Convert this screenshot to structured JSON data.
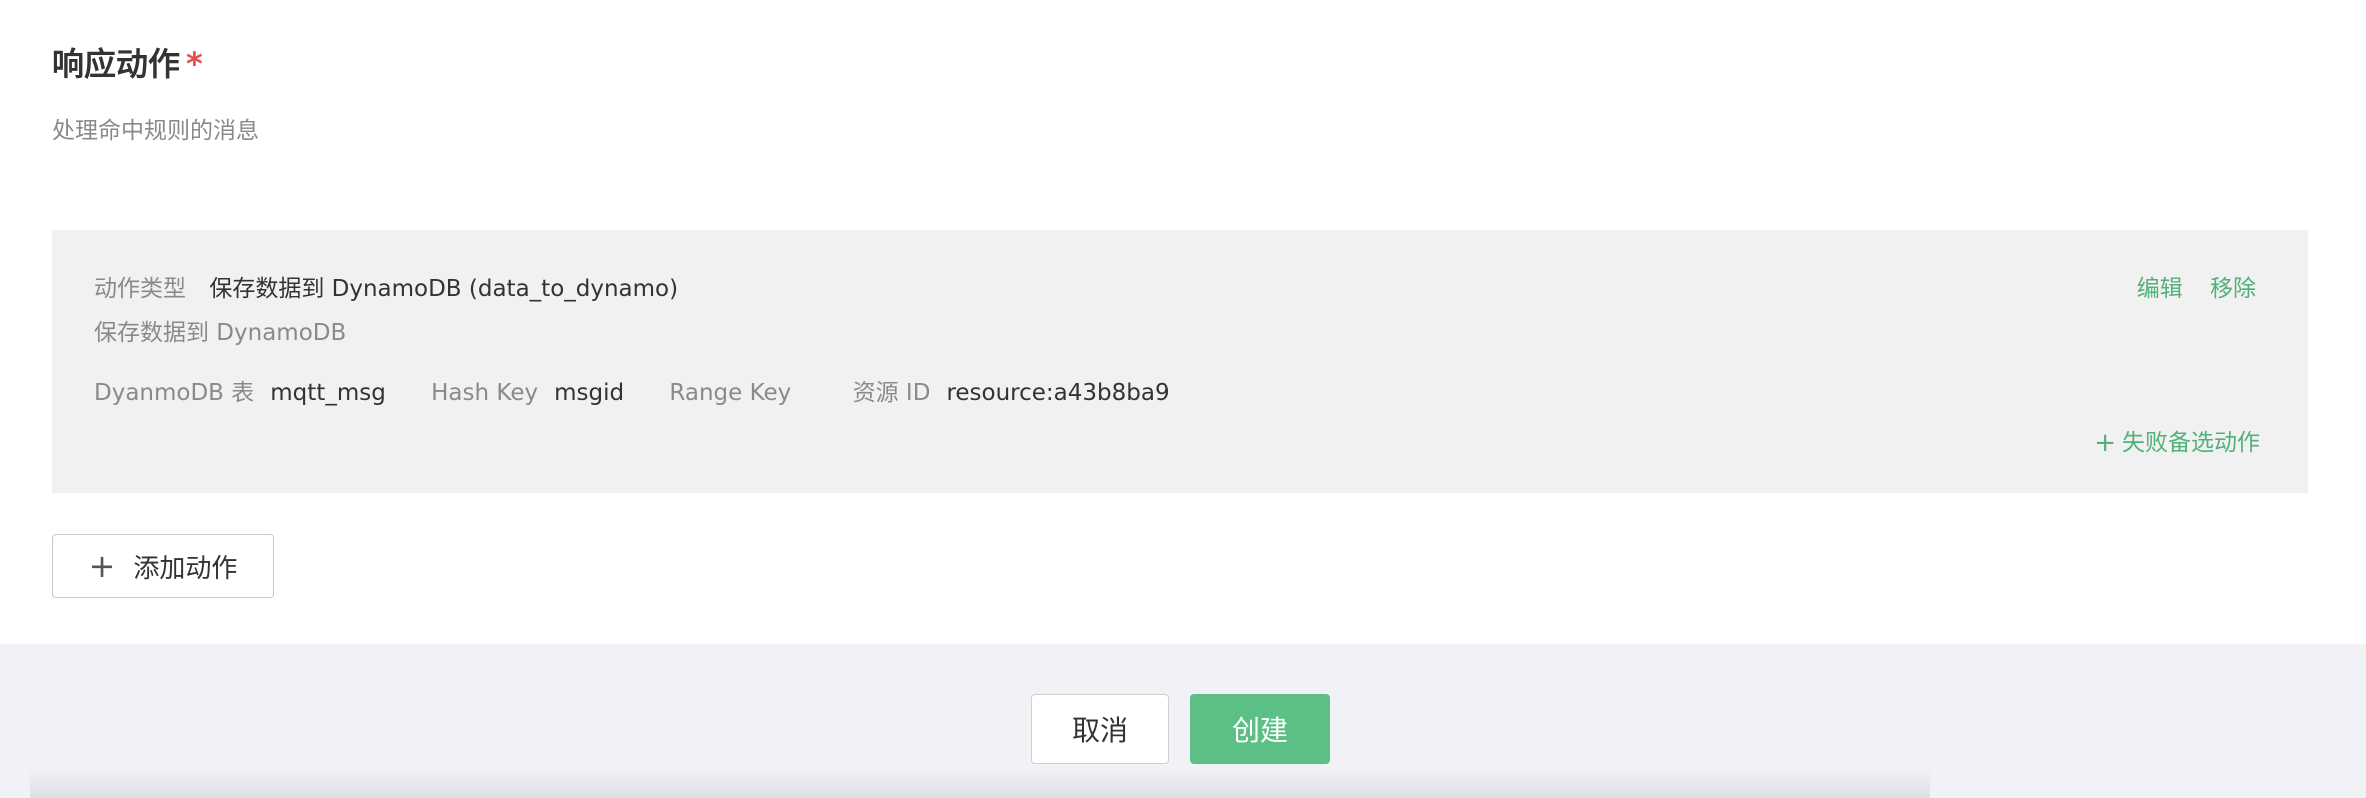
{
  "section": {
    "title": "响应动作",
    "required_mark": "*",
    "description": "处理命中规则的消息"
  },
  "action": {
    "type_label": "动作类型",
    "type_value": "保存数据到 DynamoDB (data_to_dynamo)",
    "description": "保存数据到 DynamoDB",
    "params": [
      {
        "label": "DyanmoDB 表",
        "value": "mqtt_msg"
      },
      {
        "label": "Hash Key",
        "value": "msgid"
      },
      {
        "label": "Range Key",
        "value": ""
      },
      {
        "label": "资源 ID",
        "value": "resource:a43b8ba9"
      }
    ],
    "edit_label": "编辑",
    "remove_label": "移除",
    "fallback_label": "失败备选动作"
  },
  "add_action_label": "添加动作",
  "footer": {
    "cancel_label": "取消",
    "create_label": "创建"
  },
  "colors": {
    "accent": "#52b07a",
    "primary_button": "#5cbf85",
    "required": "#e34d4d"
  }
}
